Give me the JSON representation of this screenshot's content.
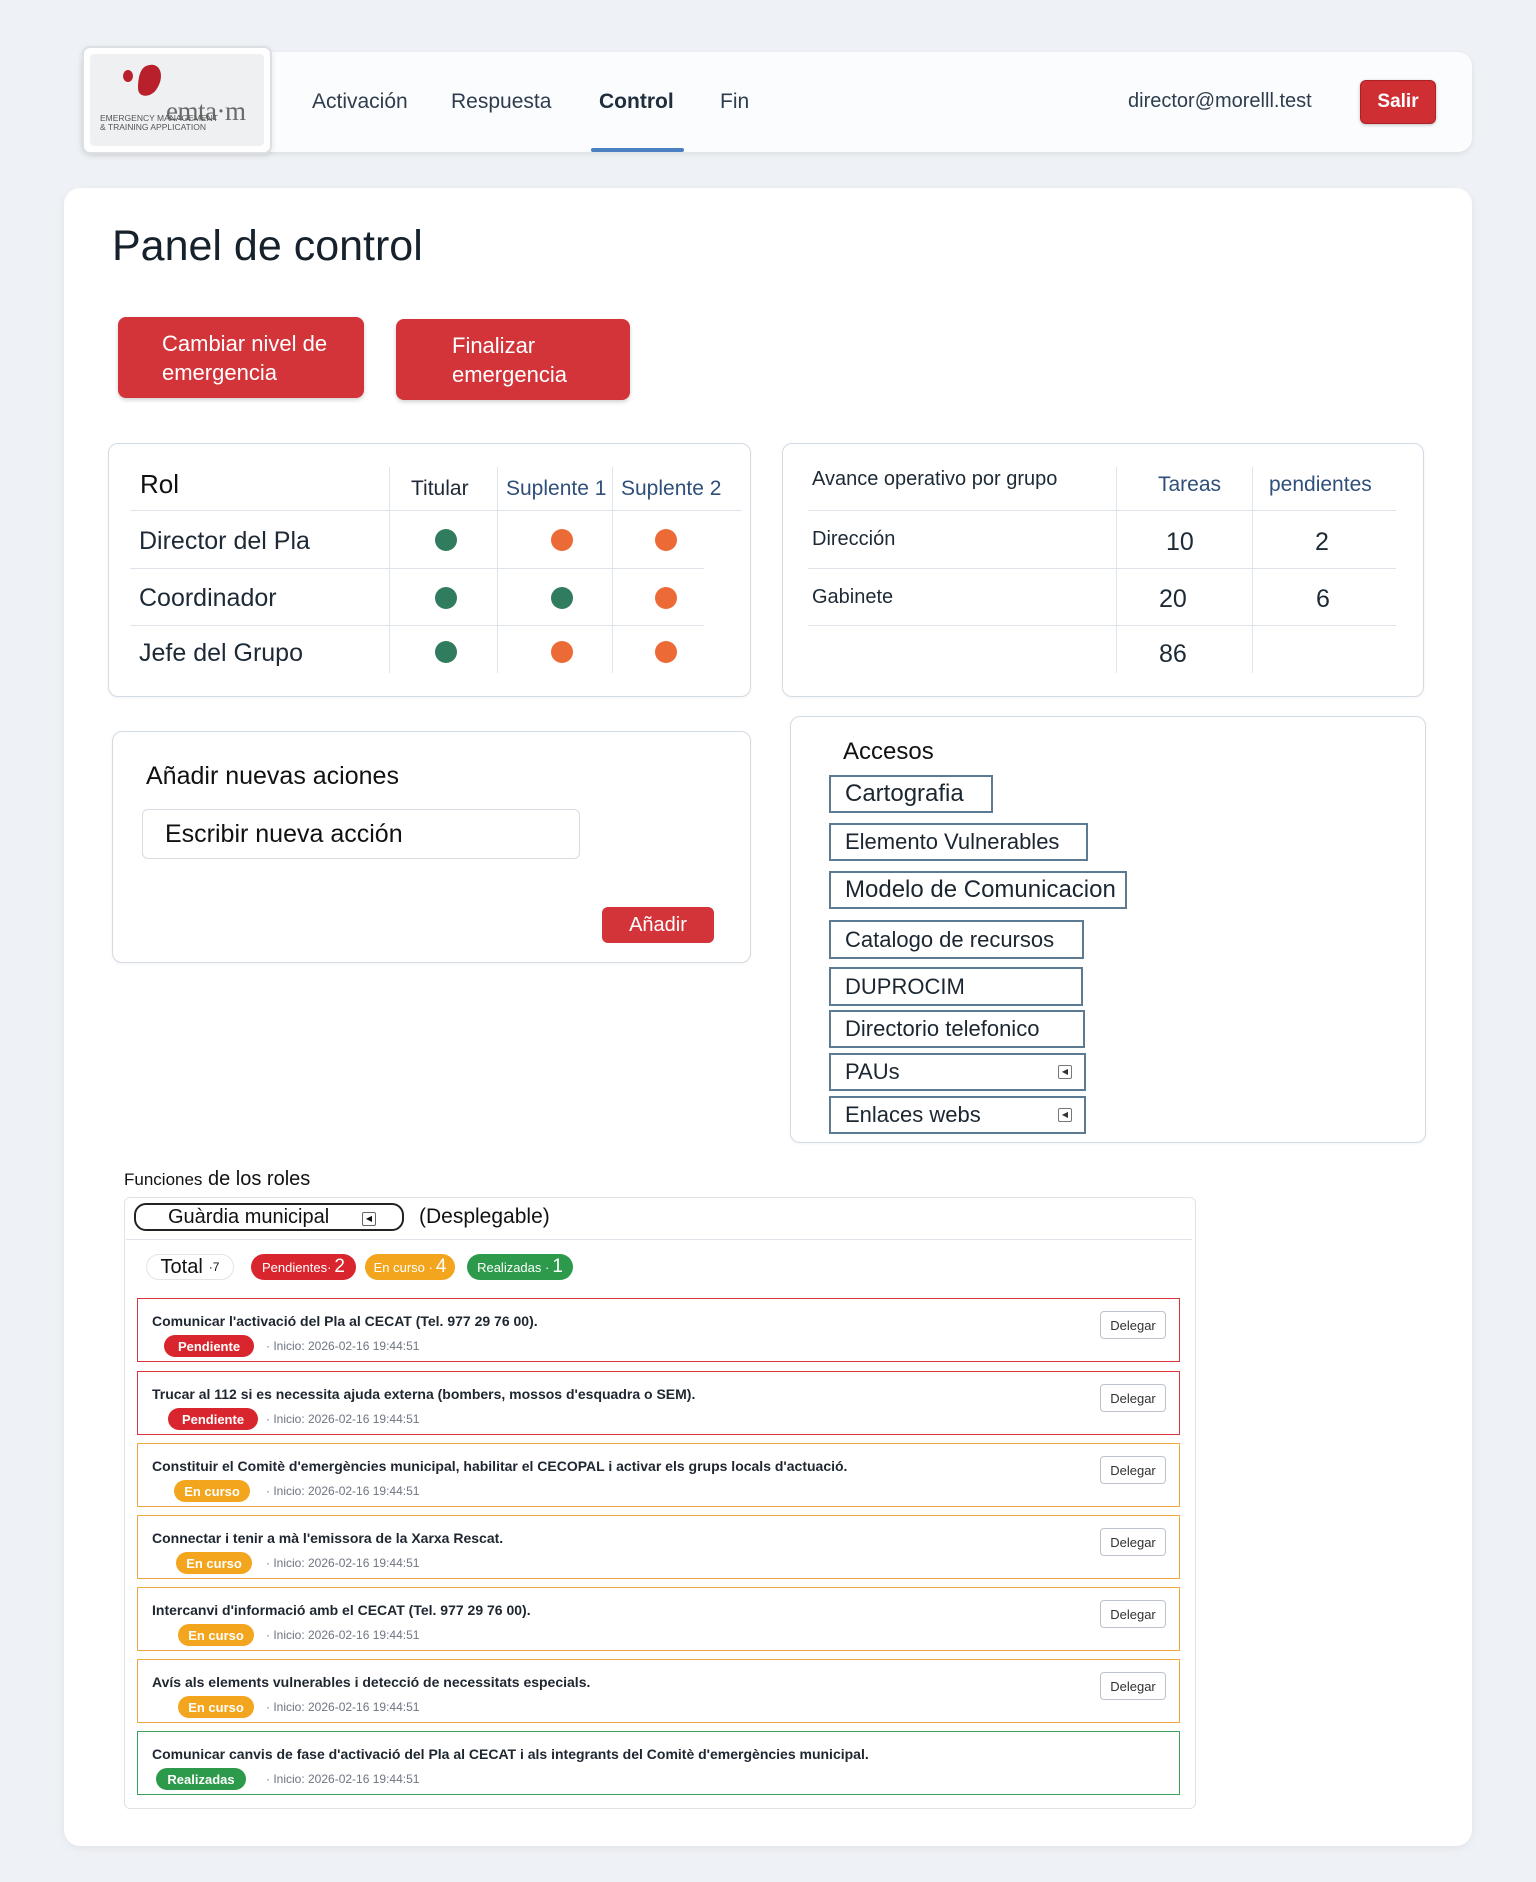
{
  "brand": {
    "logo_text": "emta·m",
    "logo_sub": "Emergency Management & Training Application"
  },
  "nav": {
    "items": [
      "Activación",
      "Respuesta",
      "Control",
      "Fin"
    ],
    "active": "Control",
    "user_email": "director@morelll.test",
    "logout_label": "Salir"
  },
  "page": {
    "title": "Panel de control",
    "actions": {
      "change_level": "Cambiar nivel de emergencia",
      "finish": "Finalizar emergencia"
    }
  },
  "roles_table": {
    "headers": [
      "Rol",
      "Titular",
      "Suplente 1",
      "Suplente 2"
    ],
    "rows": [
      {
        "role": "Director del Pla",
        "status": [
          "green",
          "orange",
          "orange"
        ]
      },
      {
        "role": "Coordinador",
        "status": [
          "green",
          "green",
          "orange"
        ]
      },
      {
        "role": "Jefe del Grupo",
        "status": [
          "green",
          "orange",
          "orange"
        ]
      }
    ],
    "colors": {
      "green": "#2f7d5e",
      "orange": "#ec6a35"
    }
  },
  "progress_table": {
    "headers": [
      "Avance operativo por grupo",
      "Tareas",
      "pendientes"
    ],
    "rows": [
      {
        "group": "Dirección",
        "tareas": "10",
        "pendientes": "2"
      },
      {
        "group": "Gabinete",
        "tareas": "20",
        "pendientes": "6"
      },
      {
        "group": "",
        "tareas": "86",
        "pendientes": ""
      }
    ]
  },
  "new_action": {
    "title": "Añadir nuevas aciones",
    "placeholder": "Escribir nueva acción",
    "button": "Añadir"
  },
  "access": {
    "title": "Accesos",
    "items": [
      "Cartografia",
      "Elemento Vulnerables",
      "Modelo de Comunicacion",
      "Catalogo de recursos",
      "DUPROCIM",
      "Directorio telefonico",
      "PAUs",
      "Enlaces webs"
    ]
  },
  "functions": {
    "title_small": "Funciones",
    "title_rest": "de los roles",
    "selected_role": "Guàrdia municipal",
    "dropdown_hint": "(Desplegable)",
    "summary": {
      "total_label": "Total",
      "total_value": "·7",
      "pending_label": "Pendientes·",
      "pending_value": "2",
      "inprogress_label": "En curso ·",
      "inprogress_value": "4",
      "done_label": "Realizadas ·",
      "done_value": "1"
    },
    "delegate_label": "Delegar",
    "tasks": [
      {
        "text": "Comunicar l'activació del Pla al CECAT (Tel. 977 29 76 00).",
        "status": "Pendiente",
        "time": "· Inicio: 2026-02-16 19:44:51"
      },
      {
        "text": "Trucar al 112 si es necessita ajuda externa (bombers, mossos d'esquadra o SEM).",
        "status": "Pendiente",
        "time": "· Inicio: 2026-02-16 19:44:51"
      },
      {
        "text": "Constituir el Comitè d'emergències municipal, habilitar el CECOPAL i activar els grups locals d'actuació.",
        "status": "En curso",
        "time": "· Inicio: 2026-02-16 19:44:51"
      },
      {
        "text": "Connectar i tenir a mà l'emissora de la Xarxa Rescat.",
        "status": "En curso",
        "time": "· Inicio: 2026-02-16 19:44:51"
      },
      {
        "text": "Intercanvi d'informació amb el CECAT (Tel. 977 29 76 00).",
        "status": "En curso",
        "time": "· Inicio: 2026-02-16 19:44:51"
      },
      {
        "text": "Avís als elements vulnerables i detecció de necessitats especials.",
        "status": "En curso",
        "time": "· Inicio: 2026-02-16 19:44:51"
      },
      {
        "text": "Comunicar canvis de fase d'activació del Pla al CECAT i als integrants del Comitè d'emergències municipal.",
        "status": "Realizadas",
        "time": "· Inicio: 2026-02-16 19:44:51"
      }
    ]
  }
}
